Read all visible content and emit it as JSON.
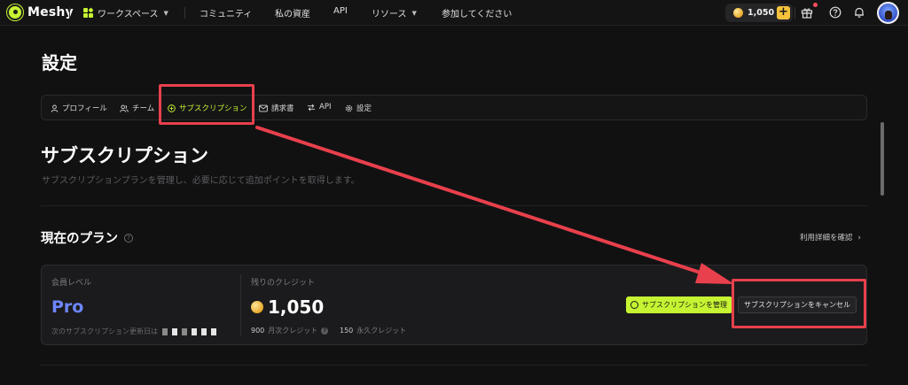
{
  "brand": {
    "name": "Meshy"
  },
  "nav": {
    "workspace": "ワークスペース",
    "community": "コミュニティ",
    "assets": "私の資産",
    "api": "API",
    "resources": "リソース",
    "join": "参加してください"
  },
  "header": {
    "credits": "1,050",
    "plus_label": "+",
    "icons": [
      "gift-icon",
      "help-icon",
      "bell-icon",
      "avatar"
    ]
  },
  "page": {
    "title": "設定"
  },
  "tabs": [
    {
      "label": "プロフィール",
      "icon": "user-icon",
      "active": false
    },
    {
      "label": "チーム",
      "icon": "team-icon",
      "active": false
    },
    {
      "label": "サブスクリプション",
      "icon": "plus-circle-icon",
      "active": true
    },
    {
      "label": "請求書",
      "icon": "mail-icon",
      "active": false
    },
    {
      "label": "API",
      "icon": "api-icon",
      "active": false
    },
    {
      "label": "設定",
      "icon": "gear-icon",
      "active": false
    }
  ],
  "subscription": {
    "title": "サブスクリプション",
    "subtitle": "サブスクリプションプランを管理し、必要に応じて追加ポイントを取得します。"
  },
  "current_plan": {
    "title": "現在のプラン",
    "usage_link": "利用詳細を確認",
    "member_level_label": "会員レベル",
    "member_level": "Pro",
    "renewal_label": "次のサブスクリプション更新日は",
    "remaining_credits_label": "残りのクレジット",
    "remaining_credits": "1,050",
    "monthly_credits_value": "900",
    "monthly_credits_label": "月次クレジット",
    "permanent_credits_value": "150",
    "permanent_credits_label": "永久クレジット",
    "manage_button": "サブスクリプションを管理",
    "cancel_button": "サブスクリプションをキャンセル"
  },
  "colors": {
    "accent": "#c6f432",
    "pro": "#6e86ff",
    "annotation": "#e8404c",
    "background": "#111112"
  }
}
